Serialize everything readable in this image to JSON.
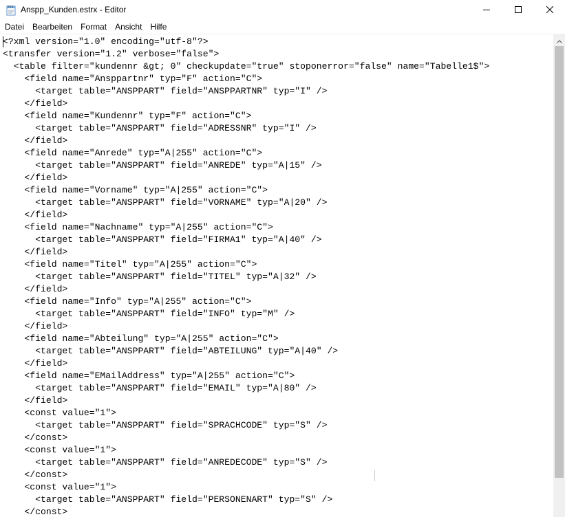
{
  "window": {
    "title": "Anspp_Kunden.estrx - Editor",
    "icon": "notepad-icon",
    "controls": {
      "minimize_icon": "minimize-icon",
      "maximize_icon": "maximize-icon",
      "close_icon": "close-icon"
    }
  },
  "menu": {
    "items": [
      {
        "label": "Datei"
      },
      {
        "label": "Bearbeiten"
      },
      {
        "label": "Format"
      },
      {
        "label": "Ansicht"
      },
      {
        "label": "Hilfe"
      }
    ]
  },
  "editor": {
    "lines": [
      "<?xml version=\"1.0\" encoding=\"utf-8\"?>",
      "<transfer version=\"1.2\" verbose=\"false\">",
      "  <table filter=\"kundennr &gt; 0\" checkupdate=\"true\" stoponerror=\"false\" name=\"Tabelle1$\">",
      "    <field name=\"Ansppartnr\" typ=\"F\" action=\"C\">",
      "      <target table=\"ANSPPART\" field=\"ANSPPARTNR\" typ=\"I\" />",
      "    </field>",
      "    <field name=\"Kundennr\" typ=\"F\" action=\"C\">",
      "      <target table=\"ANSPPART\" field=\"ADRESSNR\" typ=\"I\" />",
      "    </field>",
      "    <field name=\"Anrede\" typ=\"A|255\" action=\"C\">",
      "      <target table=\"ANSPPART\" field=\"ANREDE\" typ=\"A|15\" />",
      "    </field>",
      "    <field name=\"Vorname\" typ=\"A|255\" action=\"C\">",
      "      <target table=\"ANSPPART\" field=\"VORNAME\" typ=\"A|20\" />",
      "    </field>",
      "    <field name=\"Nachname\" typ=\"A|255\" action=\"C\">",
      "      <target table=\"ANSPPART\" field=\"FIRMA1\" typ=\"A|40\" />",
      "    </field>",
      "    <field name=\"Titel\" typ=\"A|255\" action=\"C\">",
      "      <target table=\"ANSPPART\" field=\"TITEL\" typ=\"A|32\" />",
      "    </field>",
      "    <field name=\"Info\" typ=\"A|255\" action=\"C\">",
      "      <target table=\"ANSPPART\" field=\"INFO\" typ=\"M\" />",
      "    </field>",
      "    <field name=\"Abteilung\" typ=\"A|255\" action=\"C\">",
      "      <target table=\"ANSPPART\" field=\"ABTEILUNG\" typ=\"A|40\" />",
      "    </field>",
      "    <field name=\"EMailAddress\" typ=\"A|255\" action=\"C\">",
      "      <target table=\"ANSPPART\" field=\"EMAIL\" typ=\"A|80\" />",
      "    </field>",
      "    <const value=\"1\">",
      "      <target table=\"ANSPPART\" field=\"SPRACHCODE\" typ=\"S\" />",
      "    </const>",
      "    <const value=\"1\">",
      "      <target table=\"ANSPPART\" field=\"ANREDECODE\" typ=\"S\" />",
      "    </const>",
      "    <const value=\"1\">",
      "      <target table=\"ANSPPART\" field=\"PERSONENART\" typ=\"S\" />",
      "    </const>"
    ]
  },
  "scrollbar": {
    "up_icon": "scroll-up-arrow-icon",
    "position": 0
  }
}
